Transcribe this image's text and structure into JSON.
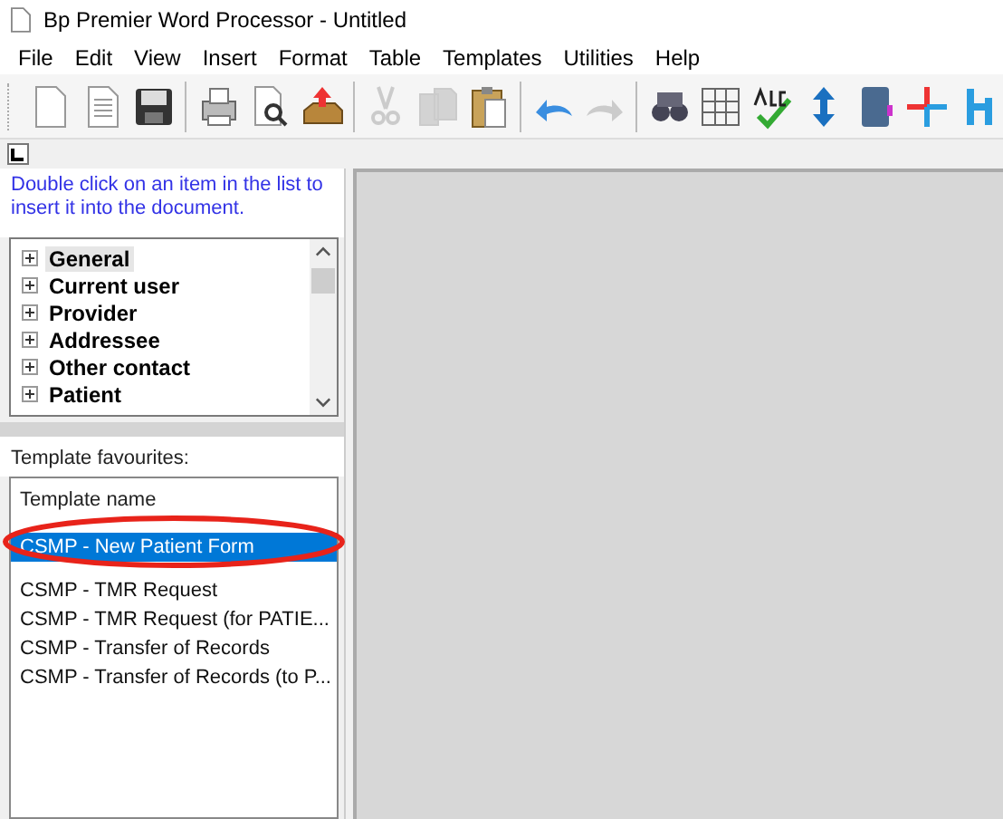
{
  "window": {
    "title": "Bp Premier Word Processor - Untitled"
  },
  "menu": [
    "File",
    "Edit",
    "View",
    "Insert",
    "Format",
    "Table",
    "Templates",
    "Utilities",
    "Help"
  ],
  "toolbar": [
    [
      {
        "kind": "new",
        "disabled": false
      },
      {
        "kind": "document",
        "disabled": false
      },
      {
        "kind": "save",
        "disabled": false
      }
    ],
    [
      {
        "kind": "print",
        "disabled": false
      },
      {
        "kind": "preview",
        "disabled": false
      },
      {
        "kind": "export",
        "disabled": false
      }
    ],
    [
      {
        "kind": "cut",
        "disabled": true
      },
      {
        "kind": "copy",
        "disabled": true
      },
      {
        "kind": "paste",
        "disabled": false
      }
    ],
    [
      {
        "kind": "undo",
        "disabled": false
      },
      {
        "kind": "redo",
        "disabled": true
      }
    ],
    [
      {
        "kind": "find",
        "disabled": false
      },
      {
        "kind": "table",
        "disabled": false
      },
      {
        "kind": "spell",
        "disabled": false
      },
      {
        "kind": "updown",
        "disabled": false
      },
      {
        "kind": "book",
        "disabled": false
      },
      {
        "kind": "cross",
        "disabled": false
      },
      {
        "kind": "partial",
        "disabled": false
      }
    ]
  ],
  "instructions": "Double click on an item in the list to insert it into the document.",
  "tree": [
    {
      "label": "General",
      "selected": true
    },
    {
      "label": "Current user",
      "selected": false
    },
    {
      "label": "Provider",
      "selected": false
    },
    {
      "label": "Addressee",
      "selected": false
    },
    {
      "label": "Other contact",
      "selected": false
    },
    {
      "label": "Patient",
      "selected": false
    }
  ],
  "favourites": {
    "label": "Template favourites:",
    "column": "Template name",
    "rows": [
      {
        "label": "CSMP - New Patient Form",
        "selected": true
      },
      {
        "label": "CSMP - TMR Request",
        "selected": false
      },
      {
        "label": "CSMP - TMR Request (for PATIE...",
        "selected": false
      },
      {
        "label": "CSMP - Transfer of Records",
        "selected": false
      },
      {
        "label": "CSMP - Transfer of Records (to P...",
        "selected": false
      }
    ]
  }
}
